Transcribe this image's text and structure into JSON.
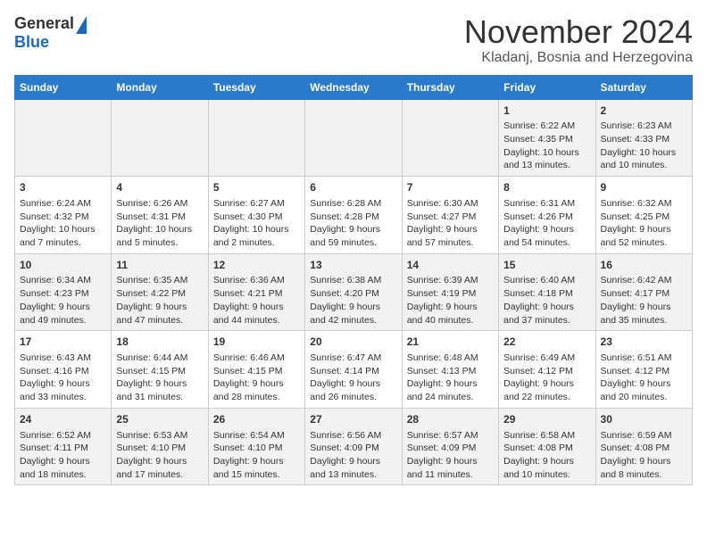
{
  "header": {
    "logo_general": "General",
    "logo_blue": "Blue",
    "month_title": "November 2024",
    "location": "Kladanj, Bosnia and Herzegovina"
  },
  "weekdays": [
    "Sunday",
    "Monday",
    "Tuesday",
    "Wednesday",
    "Thursday",
    "Friday",
    "Saturday"
  ],
  "weeks": [
    [
      {
        "day": "",
        "info": ""
      },
      {
        "day": "",
        "info": ""
      },
      {
        "day": "",
        "info": ""
      },
      {
        "day": "",
        "info": ""
      },
      {
        "day": "",
        "info": ""
      },
      {
        "day": "1",
        "info": "Sunrise: 6:22 AM\nSunset: 4:35 PM\nDaylight: 10 hours and 13 minutes."
      },
      {
        "day": "2",
        "info": "Sunrise: 6:23 AM\nSunset: 4:33 PM\nDaylight: 10 hours and 10 minutes."
      }
    ],
    [
      {
        "day": "3",
        "info": "Sunrise: 6:24 AM\nSunset: 4:32 PM\nDaylight: 10 hours and 7 minutes."
      },
      {
        "day": "4",
        "info": "Sunrise: 6:26 AM\nSunset: 4:31 PM\nDaylight: 10 hours and 5 minutes."
      },
      {
        "day": "5",
        "info": "Sunrise: 6:27 AM\nSunset: 4:30 PM\nDaylight: 10 hours and 2 minutes."
      },
      {
        "day": "6",
        "info": "Sunrise: 6:28 AM\nSunset: 4:28 PM\nDaylight: 9 hours and 59 minutes."
      },
      {
        "day": "7",
        "info": "Sunrise: 6:30 AM\nSunset: 4:27 PM\nDaylight: 9 hours and 57 minutes."
      },
      {
        "day": "8",
        "info": "Sunrise: 6:31 AM\nSunset: 4:26 PM\nDaylight: 9 hours and 54 minutes."
      },
      {
        "day": "9",
        "info": "Sunrise: 6:32 AM\nSunset: 4:25 PM\nDaylight: 9 hours and 52 minutes."
      }
    ],
    [
      {
        "day": "10",
        "info": "Sunrise: 6:34 AM\nSunset: 4:23 PM\nDaylight: 9 hours and 49 minutes."
      },
      {
        "day": "11",
        "info": "Sunrise: 6:35 AM\nSunset: 4:22 PM\nDaylight: 9 hours and 47 minutes."
      },
      {
        "day": "12",
        "info": "Sunrise: 6:36 AM\nSunset: 4:21 PM\nDaylight: 9 hours and 44 minutes."
      },
      {
        "day": "13",
        "info": "Sunrise: 6:38 AM\nSunset: 4:20 PM\nDaylight: 9 hours and 42 minutes."
      },
      {
        "day": "14",
        "info": "Sunrise: 6:39 AM\nSunset: 4:19 PM\nDaylight: 9 hours and 40 minutes."
      },
      {
        "day": "15",
        "info": "Sunrise: 6:40 AM\nSunset: 4:18 PM\nDaylight: 9 hours and 37 minutes."
      },
      {
        "day": "16",
        "info": "Sunrise: 6:42 AM\nSunset: 4:17 PM\nDaylight: 9 hours and 35 minutes."
      }
    ],
    [
      {
        "day": "17",
        "info": "Sunrise: 6:43 AM\nSunset: 4:16 PM\nDaylight: 9 hours and 33 minutes."
      },
      {
        "day": "18",
        "info": "Sunrise: 6:44 AM\nSunset: 4:15 PM\nDaylight: 9 hours and 31 minutes."
      },
      {
        "day": "19",
        "info": "Sunrise: 6:46 AM\nSunset: 4:15 PM\nDaylight: 9 hours and 28 minutes."
      },
      {
        "day": "20",
        "info": "Sunrise: 6:47 AM\nSunset: 4:14 PM\nDaylight: 9 hours and 26 minutes."
      },
      {
        "day": "21",
        "info": "Sunrise: 6:48 AM\nSunset: 4:13 PM\nDaylight: 9 hours and 24 minutes."
      },
      {
        "day": "22",
        "info": "Sunrise: 6:49 AM\nSunset: 4:12 PM\nDaylight: 9 hours and 22 minutes."
      },
      {
        "day": "23",
        "info": "Sunrise: 6:51 AM\nSunset: 4:12 PM\nDaylight: 9 hours and 20 minutes."
      }
    ],
    [
      {
        "day": "24",
        "info": "Sunrise: 6:52 AM\nSunset: 4:11 PM\nDaylight: 9 hours and 18 minutes."
      },
      {
        "day": "25",
        "info": "Sunrise: 6:53 AM\nSunset: 4:10 PM\nDaylight: 9 hours and 17 minutes."
      },
      {
        "day": "26",
        "info": "Sunrise: 6:54 AM\nSunset: 4:10 PM\nDaylight: 9 hours and 15 minutes."
      },
      {
        "day": "27",
        "info": "Sunrise: 6:56 AM\nSunset: 4:09 PM\nDaylight: 9 hours and 13 minutes."
      },
      {
        "day": "28",
        "info": "Sunrise: 6:57 AM\nSunset: 4:09 PM\nDaylight: 9 hours and 11 minutes."
      },
      {
        "day": "29",
        "info": "Sunrise: 6:58 AM\nSunset: 4:08 PM\nDaylight: 9 hours and 10 minutes."
      },
      {
        "day": "30",
        "info": "Sunrise: 6:59 AM\nSunset: 4:08 PM\nDaylight: 9 hours and 8 minutes."
      }
    ]
  ]
}
